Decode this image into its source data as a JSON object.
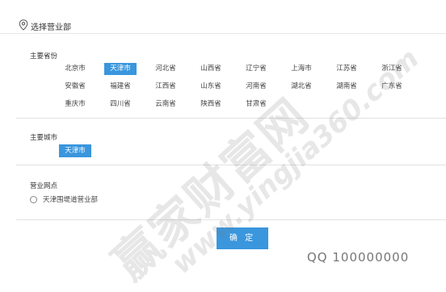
{
  "header": {
    "title": "选择营业部",
    "icon": "location-pin-icon"
  },
  "provinces": {
    "label": "主要省份",
    "selected": "天津市",
    "items": [
      "北京市",
      "天津市",
      "河北省",
      "山西省",
      "辽宁省",
      "上海市",
      "江苏省",
      "浙江省",
      "安徽省",
      "福建省",
      "江西省",
      "山东省",
      "河南省",
      "湖北省",
      "湖南省",
      "广东省",
      "重庆市",
      "四川省",
      "云南省",
      "陕西省",
      "甘肃省"
    ]
  },
  "cities": {
    "label": "主要城市",
    "items": [
      "天津市"
    ],
    "selected": "天津市"
  },
  "branches": {
    "label": "营业网点",
    "items": [
      "天津围堤道营业部"
    ]
  },
  "confirm_label": "确 定",
  "watermark": {
    "chinese": "赢家财富网",
    "url": "www.yingjia360.com"
  },
  "footer_qq": "QQ 100000000",
  "colors": {
    "accent": "#3a96dd",
    "divider": "#e2e2e2"
  }
}
